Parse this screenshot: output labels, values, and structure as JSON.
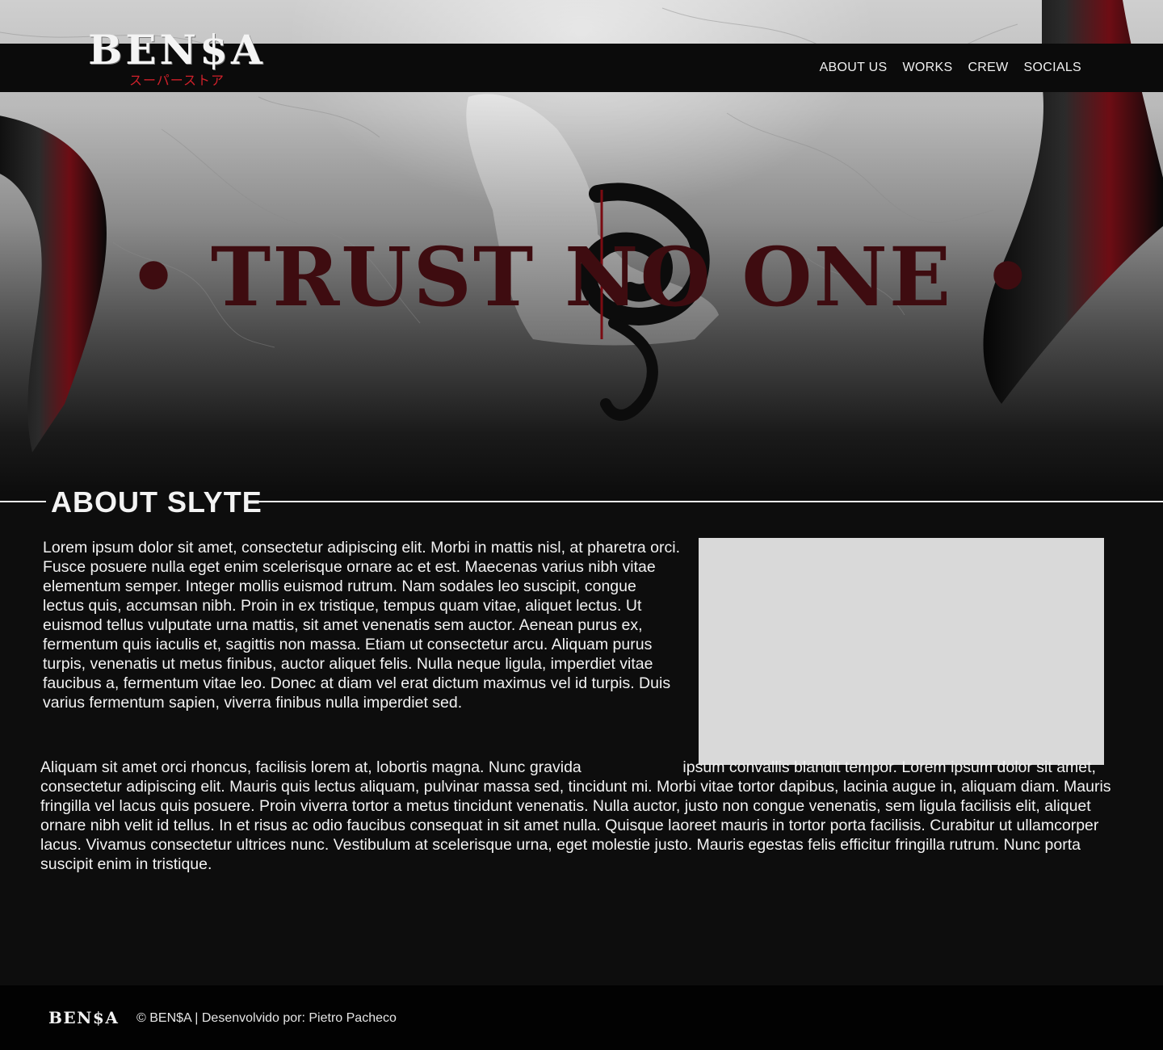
{
  "brand": {
    "logo_text": "BEN$A",
    "logo_subtitle": "スーパーストア"
  },
  "nav": {
    "items": [
      {
        "label": "ABOUT US"
      },
      {
        "label": "WORKS"
      },
      {
        "label": "CREW"
      },
      {
        "label": "SOCIALS"
      }
    ]
  },
  "hero": {
    "headline": "• TRUST NO ONE •",
    "accent_color": "#3e0c10"
  },
  "about": {
    "title": "ABOUT SLYTE",
    "paragraph_1": "Lorem ipsum dolor sit amet, consectetur adipiscing elit. Morbi in mattis nisl, at pharetra orci. Fusce posuere nulla eget enim scelerisque ornare ac et est. Maecenas varius nibh vitae elementum semper. Integer mollis euismod rutrum. Nam sodales leo suscipit, congue lectus quis, accumsan nibh. Proin in ex tristique, tempus quam vitae, aliquet lectus. Ut euismod tellus vulputate urna mattis, sit amet venenatis sem auctor. Aenean purus ex, fermentum quis iaculis et, sagittis non massa. Etiam ut consectetur arcu. Aliquam purus turpis, venenatis ut metus finibus, auctor aliquet felis. Nulla neque ligula, imperdiet vitae faucibus a, fermentum vitae leo. Donec at diam vel erat dictum maximus vel id turpis. Duis varius fermentum sapien, viverra finibus nulla imperdiet sed.",
    "paragraph_2_first": "Aliquam sit amet orci rhoncus, facilisis lorem at, lobortis magna. Nunc gravida",
    "paragraph_2_rest": "ipsum convallis blandit tempor. Lorem ipsum dolor sit amet, consectetur adipiscing elit. Mauris quis lectus aliquam, pulvinar massa sed, tincidunt mi. Morbi vitae tortor dapibus, lacinia augue in, aliquam diam. Mauris fringilla vel lacus quis posuere. Proin viverra tortor a metus tincidunt venenatis. Nulla auctor, justo non congue venenatis, sem ligula facilisis elit, aliquet ornare nibh velit id tellus. In et risus ac odio faucibus consequat in sit amet nulla. Quisque laoreet mauris in tortor porta facilisis. Curabitur ut ullamcorper lacus. Vivamus consectetur ultrices nunc. Vestibulum at scelerisque urna, eget molestie justo. Mauris egestas felis efficitur fringilla rutrum. Nunc porta suscipit enim in tristique."
  },
  "footer": {
    "logo_text": "BEN$A",
    "credits": "© BEN$A | Desenvolvido por: Pietro Pacheco"
  }
}
